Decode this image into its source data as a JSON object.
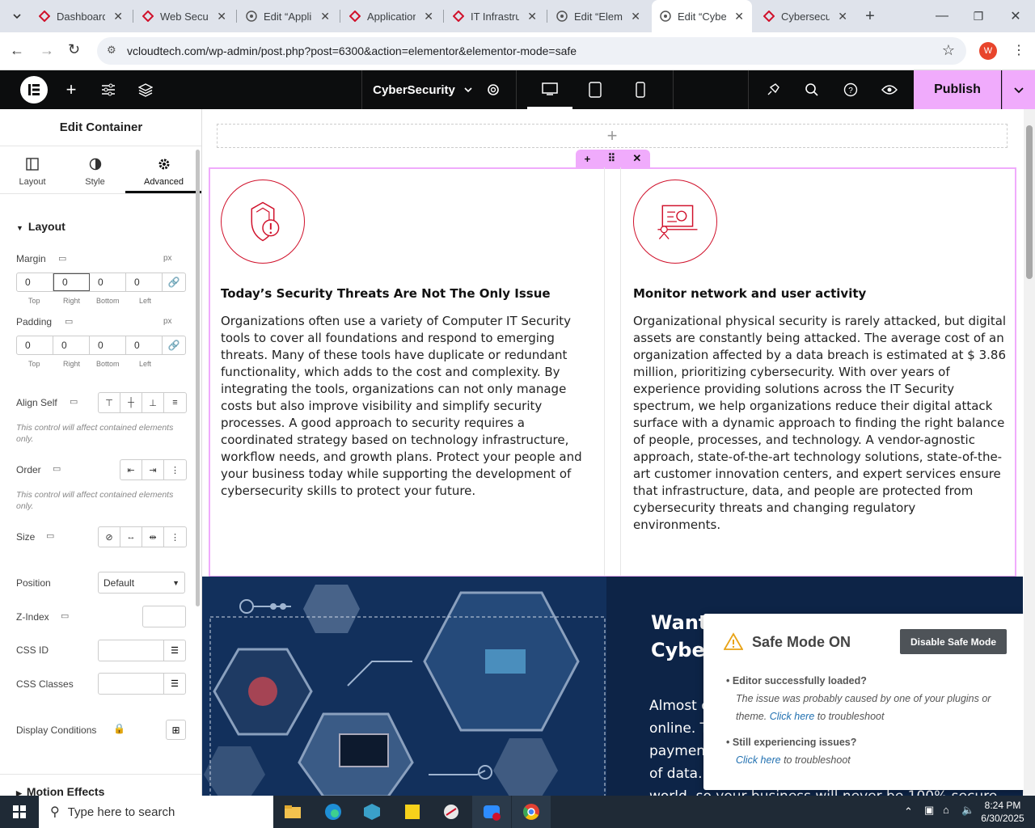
{
  "browser": {
    "tabs": [
      {
        "label": "Dashboard",
        "active": false
      },
      {
        "label": "Web Secur",
        "active": false
      },
      {
        "label": "Edit “Appli",
        "active": false
      },
      {
        "label": "Application",
        "active": false
      },
      {
        "label": "IT Infrastru",
        "active": false
      },
      {
        "label": "Edit “Elem",
        "active": false
      },
      {
        "label": "Edit “Cybe",
        "active": true
      },
      {
        "label": "Cybersecu",
        "active": false
      }
    ],
    "url": "vcloudtech.com/wp-admin/post.php?post=6300&action=elementor&elementor-mode=safe",
    "profile_initial": "W"
  },
  "editor": {
    "page_name": "CyberSecurity",
    "publish_label": "Publish"
  },
  "panel": {
    "title": "Edit Container",
    "tabs": [
      "Layout",
      "Style",
      "Advanced"
    ],
    "section_layout": "Layout",
    "margin_label": "Margin",
    "padding_label": "Padding",
    "unit": "px",
    "margin": {
      "top": "0",
      "right": "0",
      "bottom": "0",
      "left": "0"
    },
    "padding": {
      "top": "0",
      "right": "0",
      "bottom": "0",
      "left": "0"
    },
    "side_labels": [
      "Top",
      "Right",
      "Bottom",
      "Left"
    ],
    "align_self_label": "Align Self",
    "align_note": "This control will affect contained elements only.",
    "order_label": "Order",
    "order_note": "This control will affect contained elements only.",
    "size_label": "Size",
    "position_label": "Position",
    "position_value": "Default",
    "zindex_label": "Z-Index",
    "cssid_label": "CSS ID",
    "cssclasses_label": "CSS Classes",
    "display_conditions_label": "Display Conditions",
    "motion_effects_label": "Motion Effects"
  },
  "content": {
    "col1": {
      "heading": "Today’s Security Threats Are Not The Only Issue",
      "body": "Organizations often use a variety of Computer IT Security tools to cover all foundations and respond to emerging threats. Many of these tools have duplicate or redundant functionality, which adds to the cost and complexity. By integrating the tools, organizations can not only manage costs but also improve visibility and simplify security processes. A good approach to security requires a coordinated strategy based on technology infrastructure, workflow needs, and growth plans. Protect your people and your business today while supporting the development of cybersecurity skills to protect your future."
    },
    "col2": {
      "heading": "Monitor network and user activity",
      "body": "Organizational physical security is rarely attacked, but digital assets are constantly being attacked. The average cost of an organization affected by a data breach is estimated at $ 3.86 million, prioritizing cybersecurity. With over years of experience providing solutions across the IT Security spectrum, we help organizations reduce their digital attack surface with a dynamic approach to finding the right balance of people, processes, and technology. A vendor-agnostic approach, state-of-the-art technology solutions, state-of-the-art customer innovation centers, and expert services ensure that infrastructure, data, and people are protected from cybersecurity threats and changing regulatory environments."
    },
    "dark_heading_line1": "Want",
    "dark_heading_line2": "Cyber",
    "dark_text_lines": [
      "Almost e",
      "online. T",
      "payment",
      "of data.",
      "world, so your business will never be 100% secure"
    ]
  },
  "safe_mode": {
    "title": "Safe Mode ON",
    "disable_button": "Disable Safe Mode",
    "item1_title": "Editor successfully loaded?",
    "item1_text_a": "The issue was probably caused by one of your plugins or theme.",
    "item1_link": "Click here",
    "item1_text_b": "to troubleshoot",
    "item2_title": "Still experiencing issues?",
    "item2_link": "Click here",
    "item2_text_b": "to troubleshoot"
  },
  "taskbar": {
    "search_placeholder": "Type here to search",
    "time": "8:24 PM",
    "date": "6/30/2025"
  },
  "colors": {
    "accent_red": "#d0112b",
    "publish_bg": "#f0abfc",
    "container_outline": "#f0abfc",
    "editor_bar": "#0c0d0e"
  }
}
